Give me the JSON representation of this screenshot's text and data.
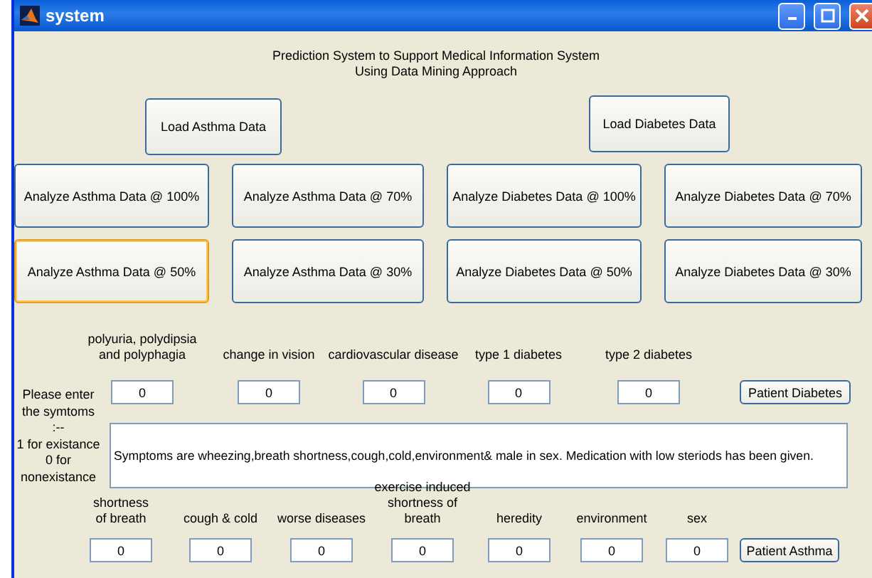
{
  "window": {
    "title": "system"
  },
  "heading": [
    "Prediction System to Support Medical Information System",
    "Using Data Mining Approach"
  ],
  "load_buttons": [
    {
      "label": "Load Asthma Data"
    },
    {
      "label": "Load Diabetes Data"
    }
  ],
  "analyze_buttons": [
    {
      "label": "Analyze Asthma Data @ 100%",
      "focused": false
    },
    {
      "label": "Analyze Asthma Data @ 70%",
      "focused": false
    },
    {
      "label": "Analyze Diabetes Data @ 100%",
      "focused": false
    },
    {
      "label": "Analyze Diabetes Data @ 70%",
      "focused": false
    },
    {
      "label": "Analyze Asthma Data @ 50%",
      "focused": true
    },
    {
      "label": "Analyze Asthma Data @ 30%",
      "focused": false
    },
    {
      "label": "Analyze Diabetes Data @ 50%",
      "focused": false
    },
    {
      "label": "Analyze Diabetes Data @ 30%",
      "focused": false
    }
  ],
  "diabetes_symptoms": [
    {
      "label": "polyuria,  polydipsia and polyphagia",
      "value": "0"
    },
    {
      "label": "change in vision",
      "value": "0"
    },
    {
      "label": "cardiovascular disease",
      "value": "0"
    },
    {
      "label": "type 1 diabetes",
      "value": "0"
    },
    {
      "label": "type 2 diabetes",
      "value": "0"
    }
  ],
  "patient_diabetes_button": "Patient Diabetes",
  "instructions": [
    "Please enter",
    "the symtoms",
    ":--",
    "1 for existance",
    "0 for",
    "nonexistance"
  ],
  "result_text": "Symptoms are wheezing,breath shortness,cough,cold,environment& male in sex. Medication with low steriods has been given.",
  "asthma_symptoms": [
    {
      "label": "shortness of breath",
      "value": "0"
    },
    {
      "label": "cough & cold",
      "value": "0"
    },
    {
      "label": "worse diseases",
      "value": "0"
    },
    {
      "label": "exercise induced shortness of breath",
      "value": "0"
    },
    {
      "label": "heredity",
      "value": "0"
    },
    {
      "label": "environment",
      "value": "0"
    },
    {
      "label": "sex",
      "value": "0"
    }
  ],
  "patient_asthma_button": "Patient Asthma"
}
